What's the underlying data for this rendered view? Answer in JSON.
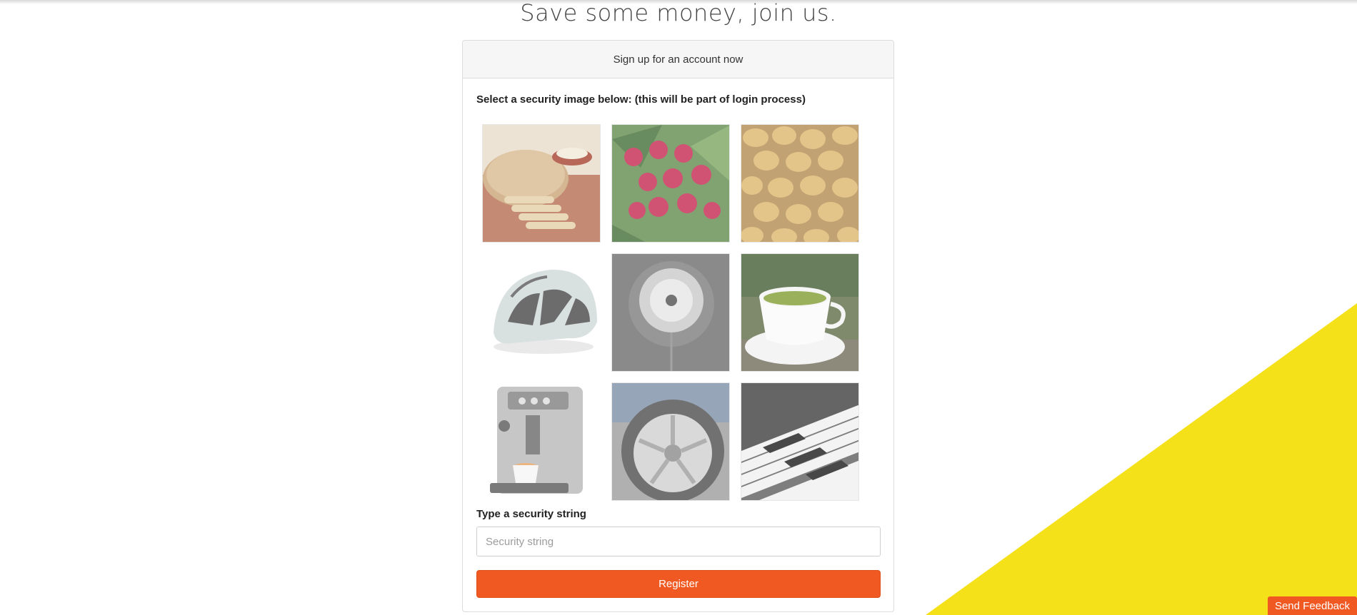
{
  "page": {
    "title": "Save some money, join us."
  },
  "card": {
    "header": "Sign up for an account now",
    "image_label": "Select a security image below: (this will be part of login process)",
    "images": [
      {
        "name": "bread"
      },
      {
        "name": "raspberries"
      },
      {
        "name": "potatoes"
      },
      {
        "name": "bike-helmet"
      },
      {
        "name": "dandelion"
      },
      {
        "name": "green-tea"
      },
      {
        "name": "coffee-machine"
      },
      {
        "name": "car-tire"
      },
      {
        "name": "piano-keys"
      }
    ],
    "string_label": "Type a security string",
    "string_placeholder": "Security string",
    "register_label": "Register"
  },
  "feedback_label": "Send Feedback",
  "colors": {
    "accent": "#f05a22",
    "yellow": "#f5e11a"
  }
}
